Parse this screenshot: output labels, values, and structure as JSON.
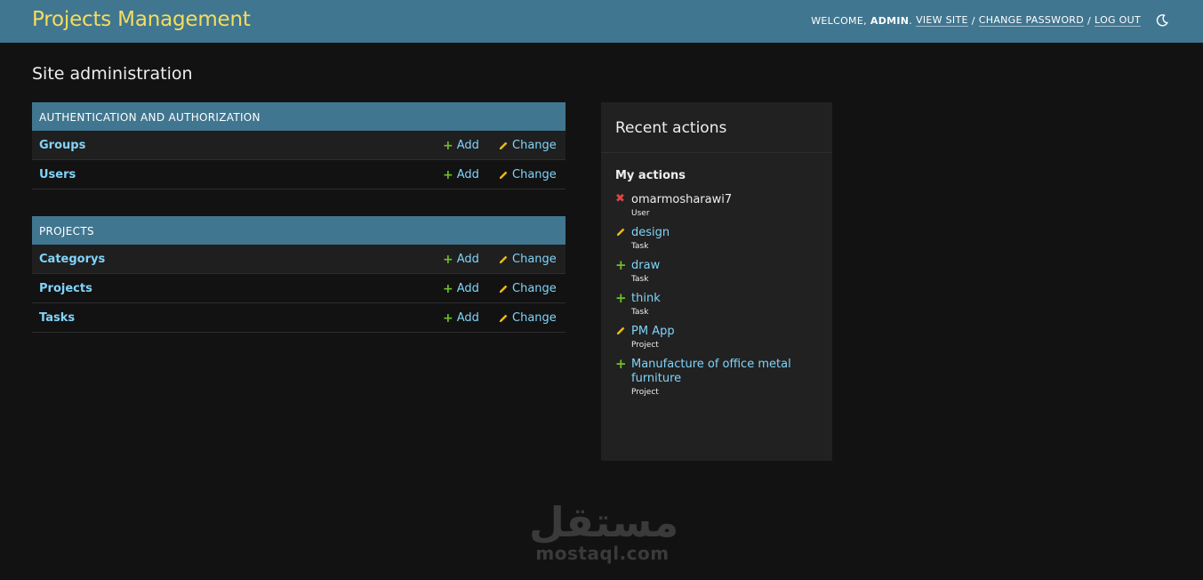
{
  "header": {
    "brand": "Projects Management",
    "welcome": "WELCOME,",
    "username": "ADMIN",
    "view_site": "VIEW SITE",
    "change_password": "CHANGE PASSWORD",
    "log_out": "LOG OUT",
    "separator": "/"
  },
  "page_title": "Site administration",
  "modules": {
    "auth": {
      "caption": "AUTHENTICATION AND AUTHORIZATION",
      "rows": [
        {
          "model": "Groups",
          "add": "Add",
          "change": "Change"
        },
        {
          "model": "Users",
          "add": "Add",
          "change": "Change"
        }
      ]
    },
    "projects": {
      "caption": "PROJECTS",
      "rows": [
        {
          "model": "Categorys",
          "add": "Add",
          "change": "Change"
        },
        {
          "model": "Projects",
          "add": "Add",
          "change": "Change"
        },
        {
          "model": "Tasks",
          "add": "Add",
          "change": "Change"
        }
      ]
    }
  },
  "recent": {
    "title": "Recent actions",
    "subtitle": "My actions",
    "items": [
      {
        "action": "delete",
        "object": "omarmosharawi7",
        "type": "User"
      },
      {
        "action": "change",
        "object": "design",
        "type": "Task"
      },
      {
        "action": "add",
        "object": "draw",
        "type": "Task"
      },
      {
        "action": "add",
        "object": "think",
        "type": "Task"
      },
      {
        "action": "change",
        "object": "PM App",
        "type": "Project"
      },
      {
        "action": "add",
        "object": "Manufacture of office metal furniture",
        "type": "Project"
      }
    ]
  },
  "watermark": {
    "arabic": "مستقل",
    "latin": "mostaql.com"
  },
  "colors": {
    "header_bg": "#417690",
    "brand": "#f5dd5d",
    "link": "#81d4fa",
    "add_green": "#70bf2b",
    "change_yellow": "#efb80b",
    "delete_red": "#dd4646",
    "background": "#121212"
  },
  "icons": {
    "add": "plus-icon",
    "change": "pencil-icon",
    "delete": "x-icon",
    "theme": "moon-icon"
  }
}
